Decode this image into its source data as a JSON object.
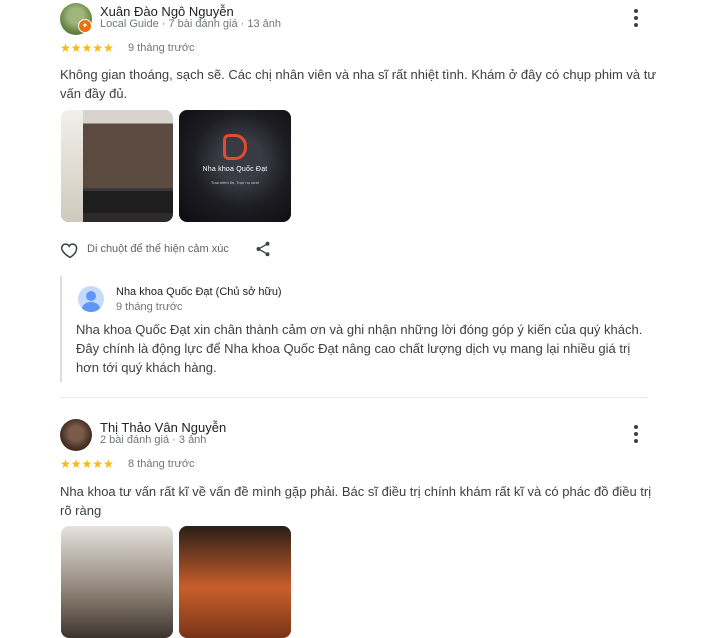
{
  "reviews": [
    {
      "name": "Xuân Đào Ngô Nguyễn",
      "meta": "Local Guide · 7 bài đánh giá · 13 ảnh",
      "rating": "★★★★★",
      "time": "9 tháng trước",
      "text": "Không gian thoáng, sạch sẽ. Các chị nhân viên và nha sĩ rất nhiệt tình. Khám ở đây có chụp phim và tư vấn đầy đủ.",
      "photo_sign_text": "Nha khoa Quốc Đạt",
      "photo_sign_sub": "Trao niềm tin, Trọn nụ cười",
      "reaction_label": "Di chuột để thể hiện cảm xúc",
      "owner_reply": {
        "name": "Nha khoa Quốc Đạt (Chủ sở hữu)",
        "time": "9 tháng trước",
        "text": "Nha khoa Quốc Đạt xin chân thành cảm ơn và ghi nhận những lời đóng góp ý kiến của quý khách. Đây chính là động lực để Nha khoa Quốc Đạt nâng cao chất lượng dịch vụ mang lại nhiều giá trị hơn tới quý khách hàng."
      }
    },
    {
      "name": "Thị Thảo Vân Nguyễn",
      "meta": "2 bài đánh giá · 3 ảnh",
      "rating": "★★★★★",
      "time": "8 tháng trước",
      "text": "Nha khoa tư vấn rất kĩ về vấn đề mình gặp phải. Bác sĩ điều trị chính khám rất kĩ và có phác đồ điều trị rõ ràng"
    }
  ],
  "icons": {
    "more": "more-vert-icon",
    "heart": "heart-outline-icon",
    "share": "share-icon",
    "local_guide": "local-guide-badge-icon"
  },
  "colors": {
    "star": "#fbbc04",
    "local_guide": "#e8710a",
    "text_secondary": "#70757a"
  }
}
